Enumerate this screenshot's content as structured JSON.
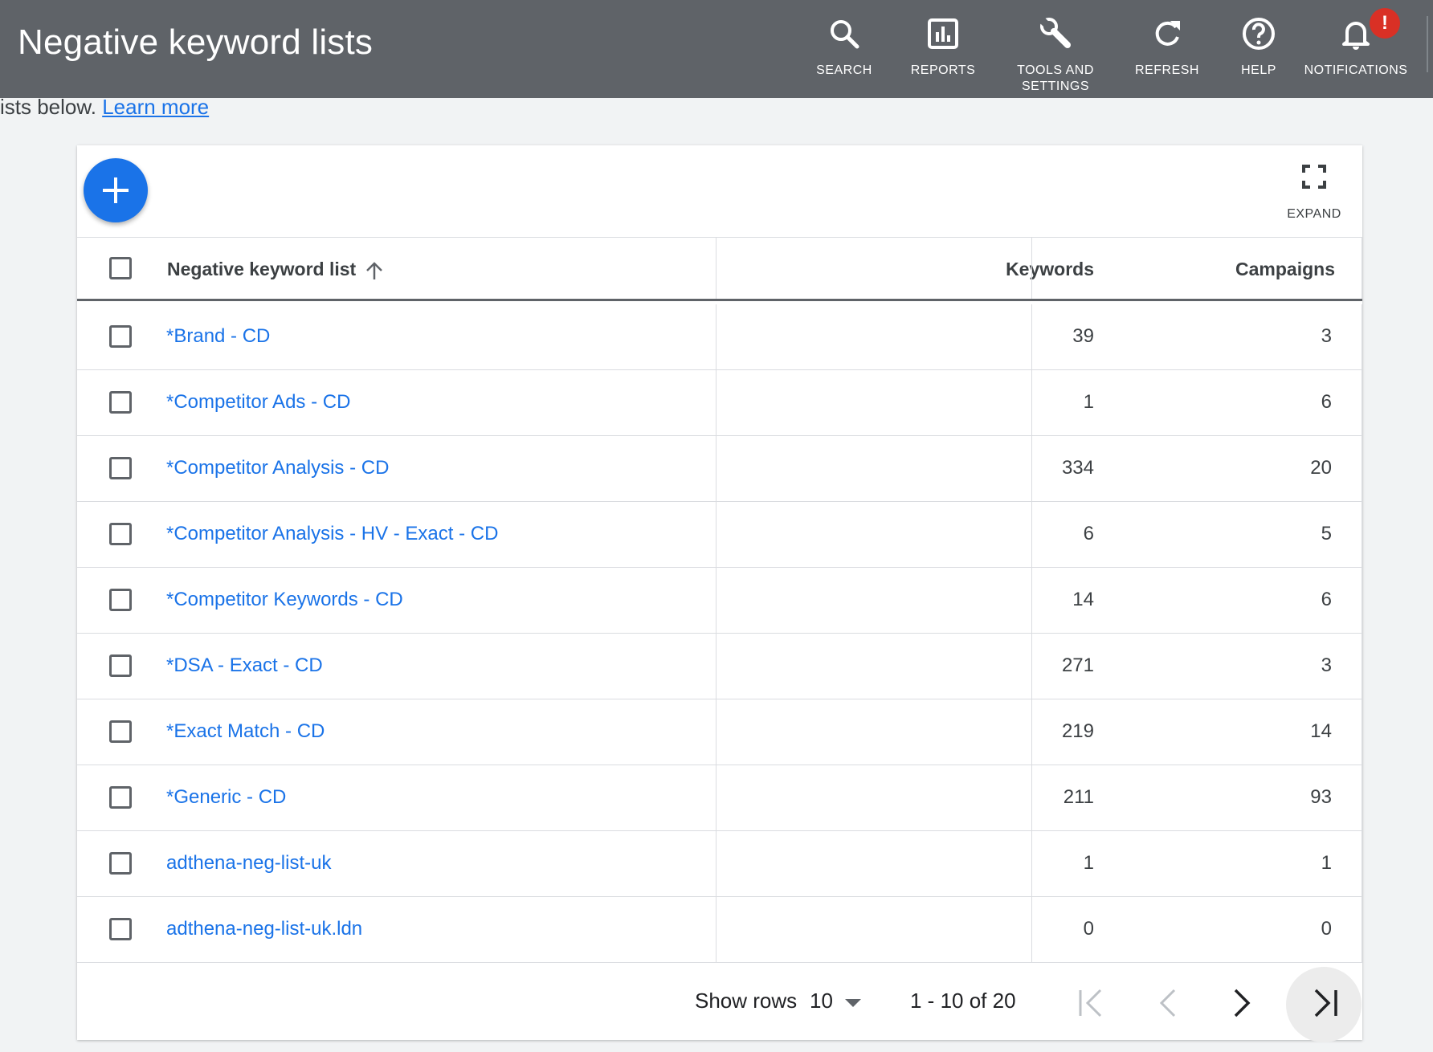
{
  "header": {
    "title": "Negative keyword lists",
    "nav": [
      {
        "label": "SEARCH",
        "icon": "search-icon"
      },
      {
        "label": "REPORTS",
        "icon": "reports-icon"
      },
      {
        "label": "TOOLS AND\nSETTINGS",
        "icon": "wrench-icon"
      },
      {
        "label": "REFRESH",
        "icon": "refresh-icon"
      },
      {
        "label": "HELP",
        "icon": "help-icon"
      },
      {
        "label": "NOTIFICATIONS",
        "icon": "bell-icon"
      }
    ],
    "notification_badge": "!"
  },
  "intro": {
    "text": "ists below.",
    "link": "Learn more"
  },
  "toolbar": {
    "add_icon": "plus-icon",
    "expand_label": "EXPAND"
  },
  "table": {
    "columns": [
      "Negative keyword list",
      "Keywords",
      "Campaigns"
    ],
    "sort": "ascending",
    "rows": [
      {
        "name": "*Brand - CD",
        "keywords": "39",
        "campaigns": "3"
      },
      {
        "name": "*Competitor Ads - CD",
        "keywords": "1",
        "campaigns": "6"
      },
      {
        "name": "*Competitor Analysis - CD",
        "keywords": "334",
        "campaigns": "20"
      },
      {
        "name": "*Competitor Analysis - HV - Exact - CD",
        "keywords": "6",
        "campaigns": "5"
      },
      {
        "name": "*Competitor Keywords - CD",
        "keywords": "14",
        "campaigns": "6"
      },
      {
        "name": "*DSA - Exact - CD",
        "keywords": "271",
        "campaigns": "3"
      },
      {
        "name": "*Exact Match - CD",
        "keywords": "219",
        "campaigns": "14"
      },
      {
        "name": "*Generic - CD",
        "keywords": "211",
        "campaigns": "93"
      },
      {
        "name": "adthena-neg-list-uk",
        "keywords": "1",
        "campaigns": "1"
      },
      {
        "name": "adthena-neg-list-uk.ldn",
        "keywords": "0",
        "campaigns": "0"
      }
    ]
  },
  "pagination": {
    "show_rows_label": "Show rows",
    "rows_per_page": "10",
    "range": "1 - 10 of 20"
  },
  "colors": {
    "topbar": "#5f6368",
    "link": "#1a73e8",
    "fab": "#1a73e8",
    "badge": "#d93025"
  }
}
